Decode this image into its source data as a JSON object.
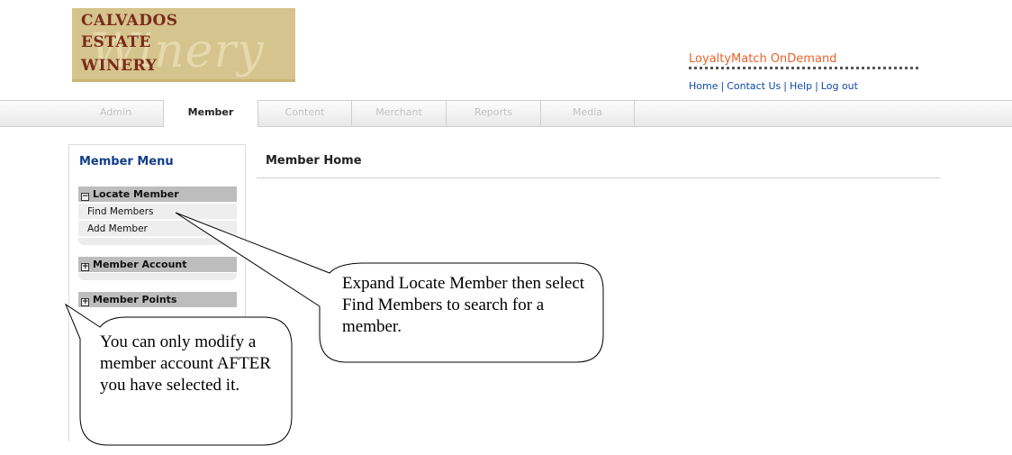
{
  "logo": {
    "line1": "CALVADOS",
    "line2": "ESTATE",
    "line3": "WINERY",
    "script": "Winery"
  },
  "brand": {
    "name": "LoyaltyMatch OnDemand"
  },
  "top_links": [
    "Home",
    "Contact Us",
    "Help",
    "Log out"
  ],
  "tabs": [
    {
      "label": "Admin",
      "active": false
    },
    {
      "label": "Member",
      "active": true
    },
    {
      "label": "Content",
      "active": false
    },
    {
      "label": "Merchant",
      "active": false
    },
    {
      "label": "Reports",
      "active": false
    },
    {
      "label": "Media",
      "active": false
    }
  ],
  "menu": {
    "title": "Member Menu",
    "sections": [
      {
        "label": "Locate Member",
        "toggle": "−",
        "items": [
          "Find Members",
          "Add Member"
        ]
      },
      {
        "label": "Member Account",
        "toggle": "+",
        "items": []
      },
      {
        "label": "Member Points",
        "toggle": "+",
        "items": []
      }
    ]
  },
  "main": {
    "title": "Member Home"
  },
  "callouts": {
    "expand": "Expand Locate Member then select Find Members to search for a member.",
    "modify": "You can only modify a member account AFTER you have selected it."
  },
  "colors": {
    "brand": "#e9622a",
    "link": "#0f4aa6",
    "menu_title": "#123e8a",
    "logo_bg": "#d5c48d",
    "logo_text": "#7a2b1a"
  }
}
